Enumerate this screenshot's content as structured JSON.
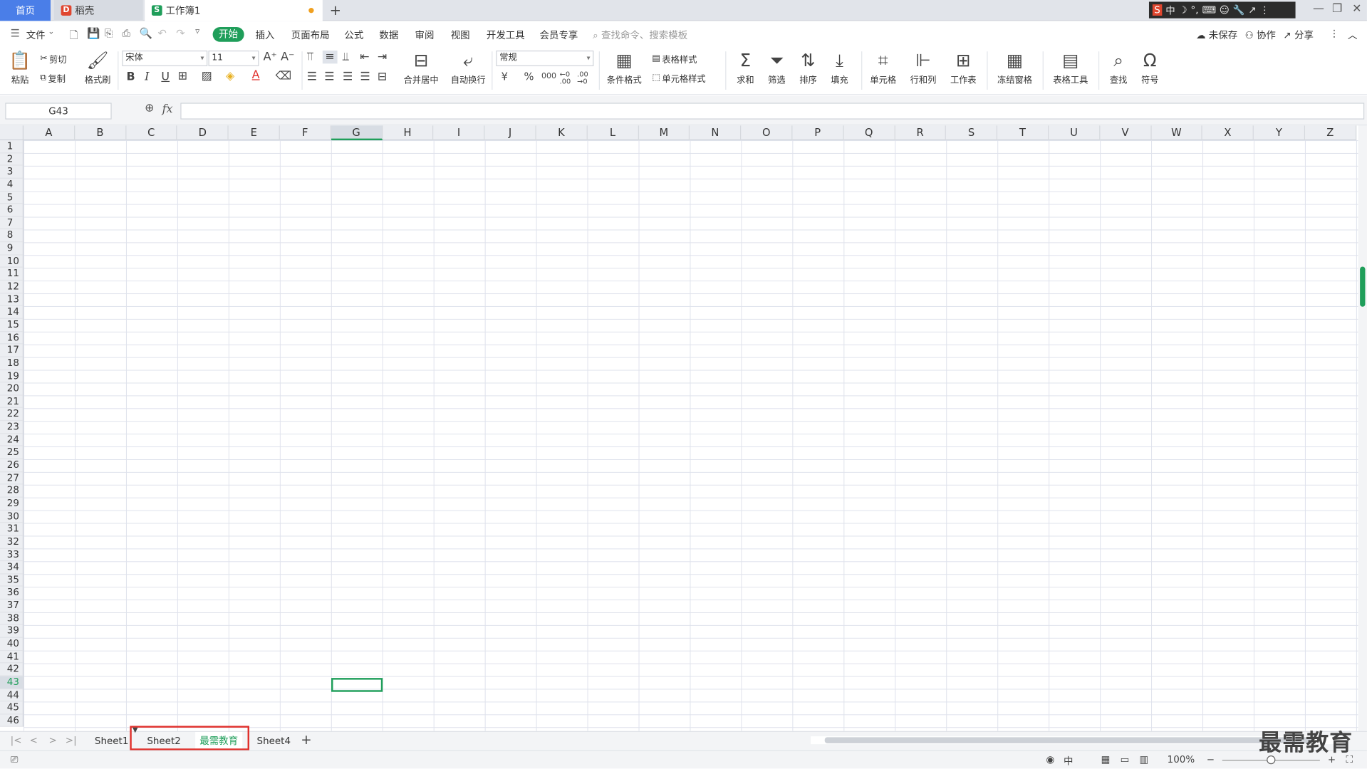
{
  "tabs": {
    "home": "首页",
    "daoke": "稻壳",
    "workbook": "工作簿1",
    "new_tab": "+"
  },
  "window": {
    "minimize": "—",
    "restore": "❐",
    "close": "✕"
  },
  "ime": {
    "items": [
      "S",
      "中",
      "☽",
      "°,",
      "⌨",
      "☺",
      "🔧",
      "↗",
      "⋮"
    ]
  },
  "menu": {
    "file": "文件",
    "active": "开始",
    "items": [
      "插入",
      "页面布局",
      "公式",
      "数据",
      "审阅",
      "视图",
      "开发工具",
      "会员专享"
    ],
    "search_placeholder": "查找命令、搜索模板",
    "unsaved": "未保存",
    "collab": "协作",
    "share": "分享"
  },
  "ribbon": {
    "paste": "粘贴",
    "cut": "剪切",
    "copy": "复制",
    "format_painter": "格式刷",
    "font_name": "宋体",
    "font_size": "11",
    "bold": "B",
    "italic": "I",
    "underline": "U",
    "merge_center": "合并居中",
    "wrap_text": "自动换行",
    "number_format": "常规",
    "currency": "¥",
    "percent": "%",
    "thousands": "000",
    "inc_decimal": "←0 .00",
    "dec_decimal": ".00 →0",
    "table_style": "表格样式",
    "cell_style": "单元格样式",
    "cond_format": "条件格式",
    "sum": "求和",
    "filter": "筛选",
    "sort": "排序",
    "fill": "填充",
    "cells": "单元格",
    "row_col": "行和列",
    "worksheet": "工作表",
    "freeze": "冻结窗格",
    "table_tools": "表格工具",
    "find": "查找",
    "symbol": "符号"
  },
  "formula": {
    "name_box": "G43",
    "fx": "fx",
    "content": ""
  },
  "grid": {
    "columns": [
      "A",
      "B",
      "C",
      "D",
      "E",
      "F",
      "G",
      "H",
      "I",
      "J",
      "K",
      "L",
      "M",
      "N",
      "O",
      "P",
      "Q",
      "R",
      "S",
      "T",
      "U",
      "V",
      "W",
      "X",
      "Y",
      "Z"
    ],
    "rows": [
      "1",
      "2",
      "3",
      "4",
      "5",
      "6",
      "7",
      "8",
      "9",
      "10",
      "11",
      "12",
      "13",
      "14",
      "15",
      "16",
      "17",
      "18",
      "19",
      "20",
      "21",
      "22",
      "23",
      "24",
      "25",
      "26",
      "27",
      "28",
      "29",
      "30",
      "31",
      "32",
      "33",
      "34",
      "35",
      "36",
      "37",
      "38",
      "39",
      "40",
      "41",
      "42",
      "43",
      "44",
      "45",
      "46"
    ],
    "active_col": "G",
    "active_row": "43"
  },
  "sheets": {
    "tabs": [
      "Sheet1",
      "Sheet2",
      "最需教育",
      "Sheet4"
    ],
    "active": "最需教育",
    "add": "+"
  },
  "status": {
    "zoom": "100%",
    "zoom_out": "−",
    "zoom_in": "+"
  },
  "watermark": "最需教育",
  "colors": {
    "accent": "#1f9e5a",
    "tab_blue": "#4a7ee8",
    "highlight": "#e0302c"
  }
}
